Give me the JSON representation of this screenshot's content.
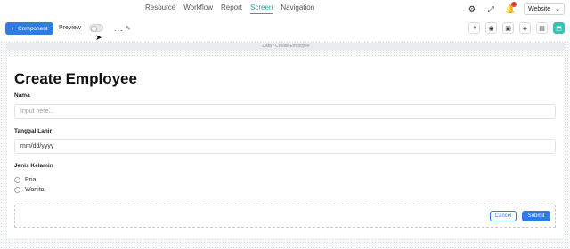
{
  "nav": {
    "items": [
      {
        "label": "Resource"
      },
      {
        "label": "Workflow"
      },
      {
        "label": "Report"
      },
      {
        "label": "Screen"
      },
      {
        "label": "Navigation"
      }
    ],
    "active": "Screen",
    "icons": [
      "settings-icon",
      "fullscreen-icon",
      "notification-icon"
    ],
    "website_select": "Website"
  },
  "toolbar": {
    "component_label": "Component",
    "preview_label": "Preview",
    "preview_on": false,
    "more_label": "...",
    "right_icons": [
      "tool-icon-1",
      "tool-icon-2",
      "tool-icon-3",
      "tool-icon-4",
      "tool-icon-5",
      "save-icon"
    ]
  },
  "breadcrumb": "Data / Create Employee",
  "form": {
    "title": "Create Employee",
    "fields": {
      "nama_label": "Nama",
      "nama_placeholder": "Input here...",
      "tanggal_label": "Tanggal Lahir",
      "tanggal_value": "mm/dd/yyyy",
      "jenis_label": "Jenis Kelamin",
      "options": [
        "Pria",
        "Wanita"
      ]
    },
    "cancel_label": "Cancel",
    "submit_label": "Submit"
  },
  "colors": {
    "primary": "#2f7ce0",
    "active_nav": "#2aa3a3",
    "save": "#33c4b3"
  }
}
